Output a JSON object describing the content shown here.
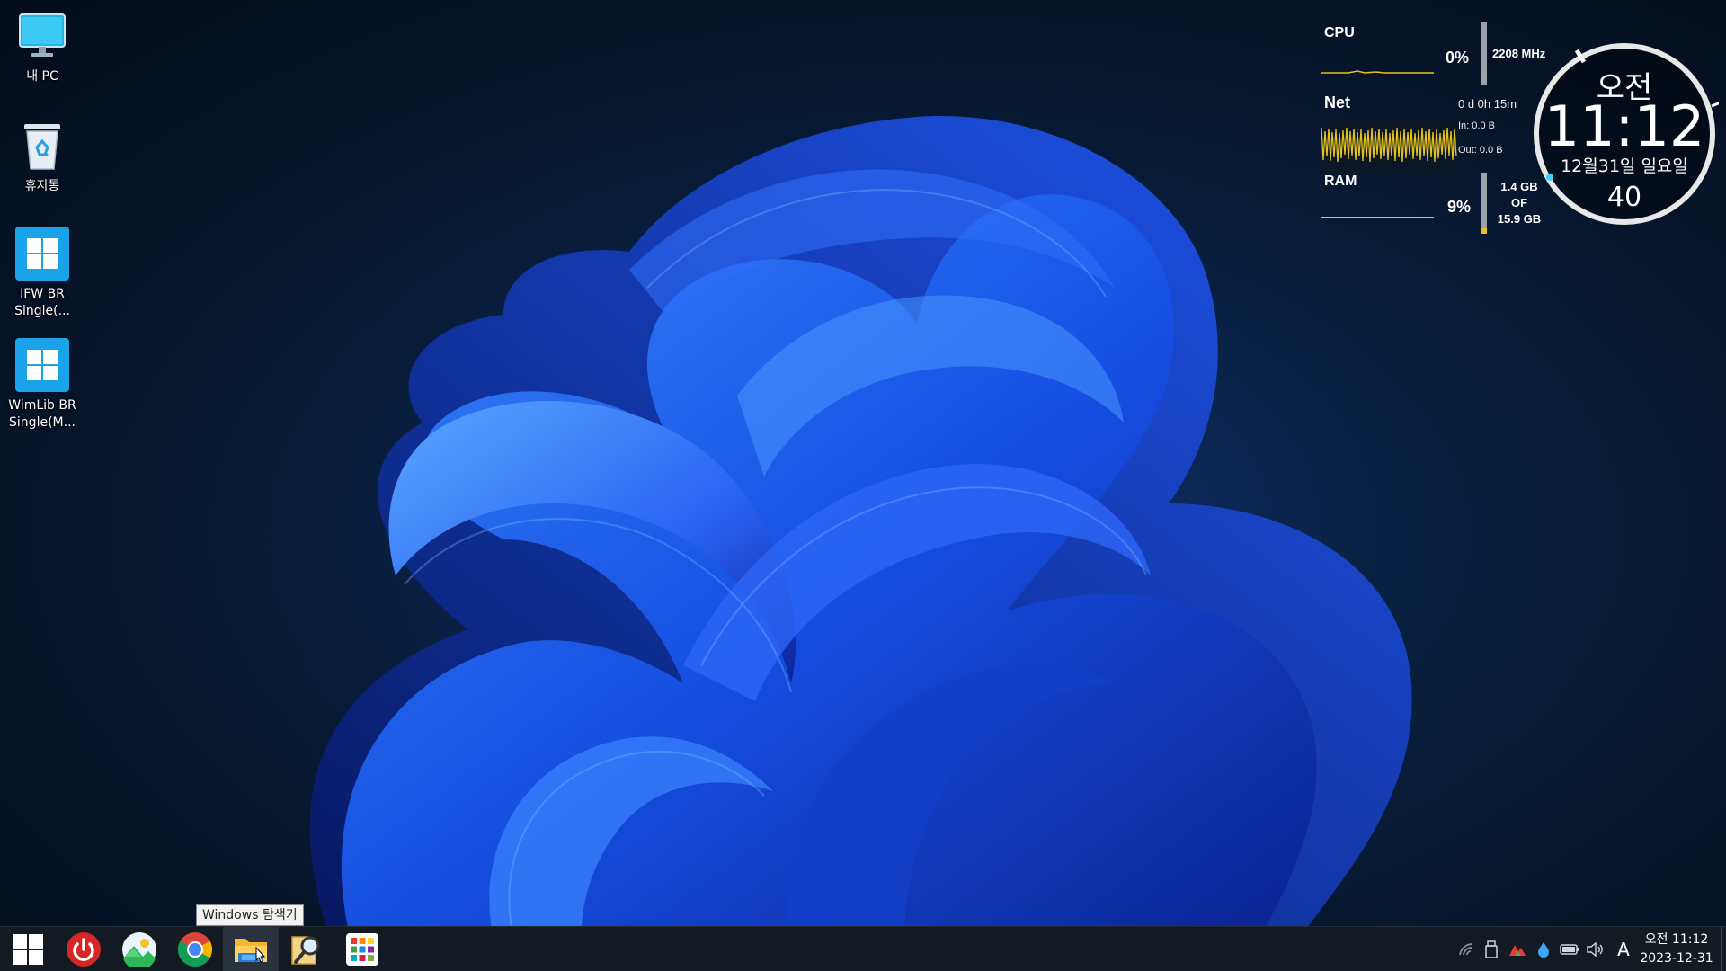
{
  "desktop": {
    "icons": [
      {
        "label": "내 PC",
        "icon": "monitor-icon"
      },
      {
        "label": "휴지통",
        "icon": "recycle-bin-icon"
      },
      {
        "label": "IFW BR Single(...",
        "icon": "windows-logo-icon"
      },
      {
        "label": "WimLib BR Single(M...",
        "icon": "windows-logo-icon"
      }
    ]
  },
  "sysmon": {
    "cpu": {
      "title": "CPU",
      "percent": "0%",
      "freq": "2208 MHz",
      "level": 0.0
    },
    "net": {
      "title": "Net",
      "uptime": "0 d 0h 15m",
      "in": "In: 0.0 B",
      "out": "Out: 0.0 B"
    },
    "ram": {
      "title": "RAM",
      "percent": "9%",
      "used": "1.4 GB",
      "of": "OF",
      "total": "15.9 GB",
      "level": 0.09
    },
    "accent": "#e6c21a"
  },
  "clock_widget": {
    "ampm": "오전",
    "time": "11:12",
    "date": "12월31일 일요일",
    "seconds": "40",
    "seconds_value": 40
  },
  "tooltip": {
    "text": "Windows 탐색기"
  },
  "taskbar": {
    "apps": [
      {
        "name": "start-button",
        "icon": "windows-logo-icon"
      },
      {
        "name": "power-button",
        "icon": "power-icon"
      },
      {
        "name": "photo-viewer-button",
        "icon": "photo-icon"
      },
      {
        "name": "chrome-button",
        "icon": "chrome-icon"
      },
      {
        "name": "file-explorer-button",
        "icon": "folder-icon",
        "active": true
      },
      {
        "name": "search-tool-button",
        "icon": "magnifier-icon"
      },
      {
        "name": "app-grid-button",
        "icon": "grid-icon"
      }
    ],
    "tray": {
      "language": "A",
      "clock_ampm_time": "오전 11:12",
      "clock_date": "2023-12-31"
    }
  }
}
